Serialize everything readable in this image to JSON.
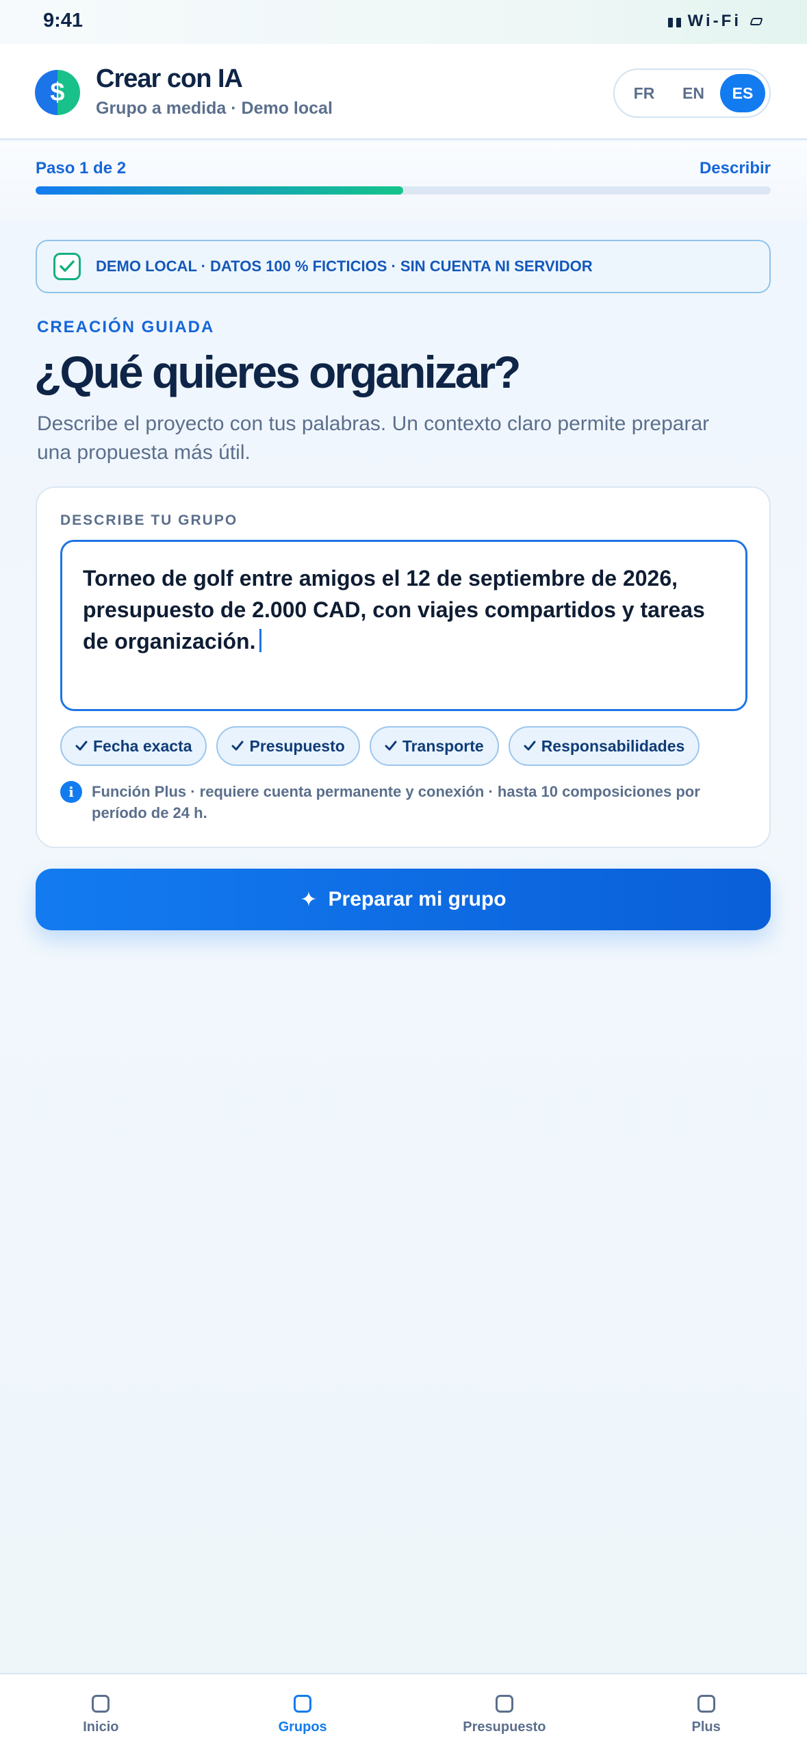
{
  "status_bar": {
    "time": "9:41",
    "network": "Wi-Fi"
  },
  "header": {
    "logo_symbol": "$",
    "title": "Crear con IA",
    "subtitle": "Grupo a medida · Demo local",
    "languages": [
      "FR",
      "EN",
      "ES"
    ],
    "active_language": "ES"
  },
  "progress": {
    "step_label": "Paso 1 de 2",
    "step_name": "Describir",
    "fraction": 0.5
  },
  "banner": {
    "text": "DEMO LOCAL · DATOS 100 % FICTICIOS · SIN CUENTA NI SERVIDOR"
  },
  "main": {
    "eyebrow": "CREACIÓN GUIADA",
    "title": "¿Qué quieres organizar?",
    "intro": "Describe el proyecto con tus palabras. Un contexto claro permite preparar una propuesta más útil."
  },
  "card": {
    "label": "DESCRIBE TU GRUPO",
    "input_value": "Torneo de golf entre amigos el 12 de septiembre de 2026, presupuesto de 2.000 CAD, con viajes compartidos y tareas de organización.",
    "chips": [
      "Fecha exacta",
      "Presupuesto",
      "Transporte",
      "Responsabilidades"
    ],
    "info": "Función Plus · requiere cuenta permanente y conexión · hasta 10 composiciones por período de 24 h."
  },
  "cta": {
    "label": "Preparar mi grupo",
    "icon": "sparkle-icon"
  },
  "tab_bar": {
    "items": [
      {
        "label": "Inicio"
      },
      {
        "label": "Grupos"
      },
      {
        "label": "Presupuesto"
      },
      {
        "label": "Plus"
      }
    ],
    "active_index": 1
  },
  "colors": {
    "accent": "#137bf0",
    "success": "#15c48a",
    "text": "#0f2547",
    "muted": "#5b6f8c"
  }
}
